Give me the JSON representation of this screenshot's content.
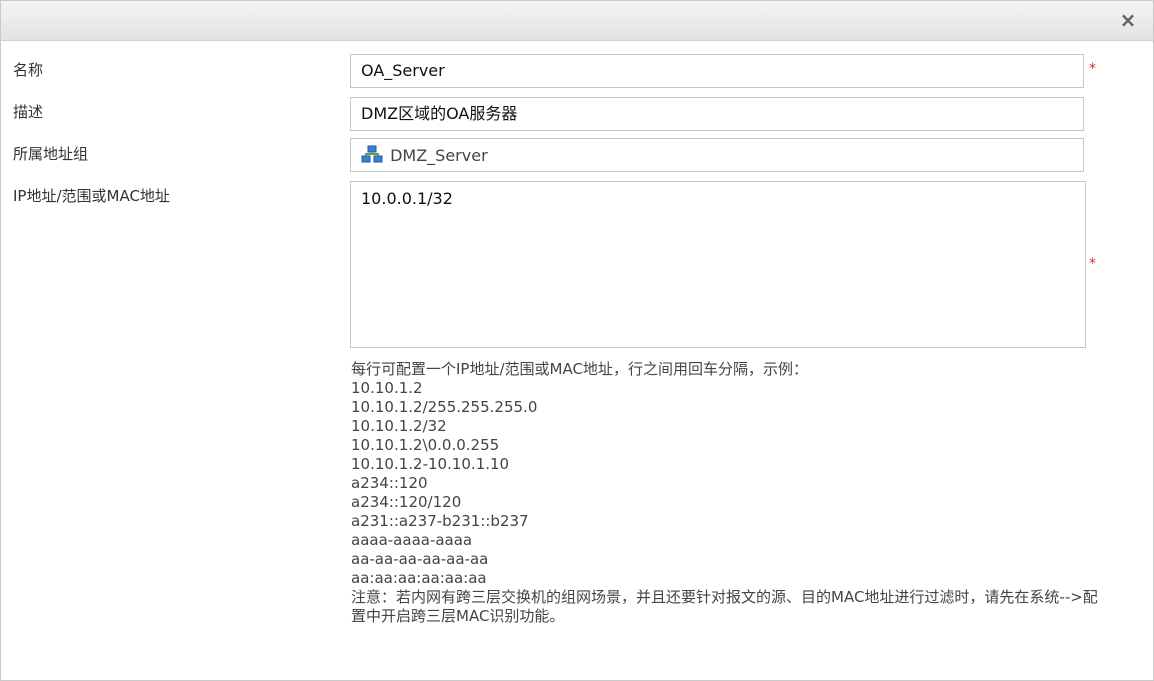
{
  "dialog": {
    "title": "",
    "close_label": "×"
  },
  "form": {
    "name": {
      "label": "名称",
      "value": "OA_Server",
      "required_mark": "*"
    },
    "description": {
      "label": "描述",
      "value": "DMZ区域的OA服务器"
    },
    "group": {
      "label": "所属地址组",
      "value": "DMZ_Server",
      "icon": "network-group-icon"
    },
    "address": {
      "label": "IP地址/范围或MAC地址",
      "value": "10.0.0.1/32",
      "required_mark": "*"
    }
  },
  "help": {
    "intro": "每行可配置一个IP地址/范围或MAC地址，行之间用回车分隔，示例：",
    "examples": [
      "10.10.1.2",
      "10.10.1.2/255.255.255.0",
      "10.10.1.2/32",
      "10.10.1.2\\0.0.0.255",
      "10.10.1.2-10.10.1.10",
      "a234::120",
      "a234::120/120",
      "a231::a237-b231::b237",
      "aaaa-aaaa-aaaa",
      "aa-aa-aa-aa-aa-aa",
      "aa:aa:aa:aa:aa:aa"
    ],
    "note": "注意：若内网有跨三层交换机的组网场景，并且还要针对报文的源、目的MAC地址进行过滤时，请先在系统-->配置中开启跨三层MAC识别功能。"
  },
  "colors": {
    "required": "#d9302c",
    "border": "#c6c6c6"
  }
}
